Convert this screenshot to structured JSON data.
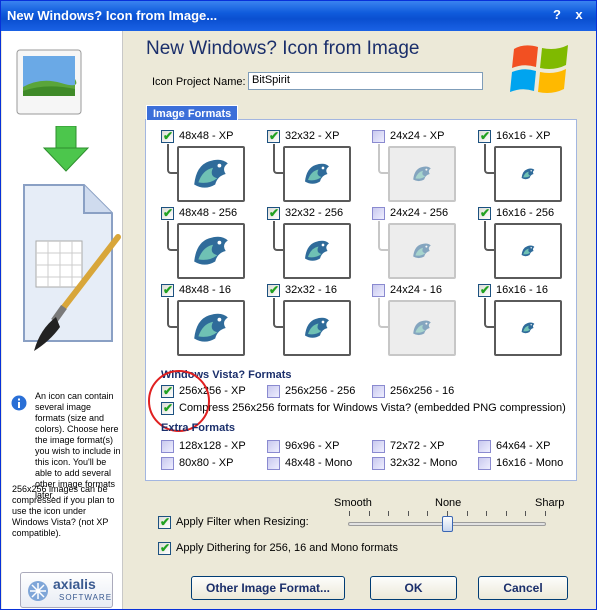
{
  "window": {
    "title": "New Windows? Icon from Image...",
    "help_label": "?",
    "close_label": "x"
  },
  "heading": "New Windows? Icon from Image",
  "project": {
    "label": "Icon Project Name:",
    "value": "BitSpirit"
  },
  "image_formats": {
    "title": "Image Formats",
    "rows": [
      [
        {
          "label": "48x48 - XP",
          "checked": true
        },
        {
          "label": "32x32 - XP",
          "checked": true
        },
        {
          "label": "24x24 - XP",
          "checked": false
        },
        {
          "label": "16x16 - XP",
          "checked": true
        }
      ],
      [
        {
          "label": "48x48 - 256",
          "checked": true
        },
        {
          "label": "32x32 - 256",
          "checked": true
        },
        {
          "label": "24x24 - 256",
          "checked": false
        },
        {
          "label": "16x16 - 256",
          "checked": true
        }
      ],
      [
        {
          "label": "48x48 - 16",
          "checked": true
        },
        {
          "label": "32x32 - 16",
          "checked": true
        },
        {
          "label": "24x24 - 16",
          "checked": false
        },
        {
          "label": "16x16 - 16",
          "checked": true
        }
      ]
    ]
  },
  "vista": {
    "title": "Windows Vista? Formats",
    "formats": [
      {
        "label": "256x256 - XP",
        "checked": true
      },
      {
        "label": "256x256 - 256",
        "checked": false
      },
      {
        "label": "256x256 - 16",
        "checked": false
      }
    ],
    "compress_label": "Compress 256x256 formats for Windows Vista? (embedded PNG compression)",
    "compress_checked": true
  },
  "extra": {
    "title": "Extra Formats",
    "formats": [
      {
        "label": "128x128 - XP",
        "checked": false
      },
      {
        "label": "96x96 - XP",
        "checked": false
      },
      {
        "label": "72x72 - XP",
        "checked": false
      },
      {
        "label": "64x64 - XP",
        "checked": false
      },
      {
        "label": "80x80 - XP",
        "checked": false
      },
      {
        "label": "48x48 - Mono",
        "checked": false
      },
      {
        "label": "32x32 - Mono",
        "checked": false
      },
      {
        "label": "16x16 - Mono",
        "checked": false
      }
    ]
  },
  "slider": {
    "smooth": "Smooth",
    "none": "None",
    "sharp": "Sharp",
    "value": 0.5
  },
  "filter_label": "Apply Filter when Resizing:",
  "dither_label": "Apply Dithering for 256, 16 and Mono formats",
  "info": {
    "text1": "An icon can contain several image formats (size and colors). Choose here the image format(s) you wish to include in this icon. You'll be able to add several other image formats later.",
    "text2": "256x256 images can be compressed if you plan to use the icon under Windows Vista? (not XP compatible)."
  },
  "logo": {
    "text": "axialis",
    "sub": "SOFTWARE"
  },
  "buttons": {
    "other": "Other Image Format...",
    "ok": "OK",
    "cancel": "Cancel"
  },
  "colors": {
    "accent": "#3c6fd9",
    "title_bar": "#0a4fd0"
  }
}
